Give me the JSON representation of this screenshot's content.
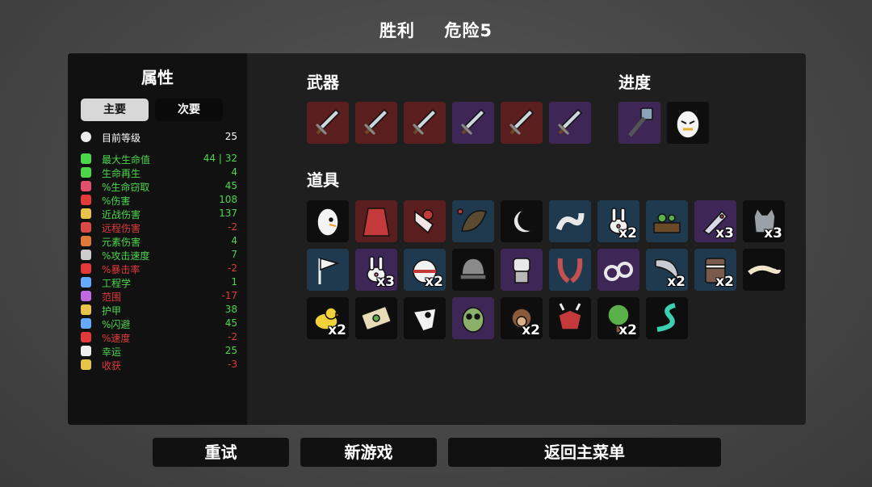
{
  "header": {
    "result": "胜利",
    "danger": "危险5"
  },
  "stats_panel": {
    "title": "属性",
    "tabs": [
      "主要",
      "次要"
    ],
    "level": {
      "label": "目前等级",
      "value": "25"
    },
    "stats": [
      {
        "icon": "heart-icon",
        "label": "最大生命值",
        "value": "44 | 32",
        "color": "#4cd64c"
      },
      {
        "icon": "heart-plus-icon",
        "label": "生命再生",
        "value": "4",
        "color": "#4cd64c"
      },
      {
        "icon": "teeth-icon",
        "label": "%生命窃取",
        "value": "45",
        "color": "#4cd64c"
      },
      {
        "icon": "damage-icon",
        "label": "%伤害",
        "value": "108",
        "color": "#4cd64c"
      },
      {
        "icon": "sword-icon",
        "label": "近战伤害",
        "value": "137",
        "color": "#4cd64c"
      },
      {
        "icon": "bow-icon",
        "label": "远程伤害",
        "value": "-2",
        "color": "#e23a3a"
      },
      {
        "icon": "flame-icon",
        "label": "元素伤害",
        "value": "4",
        "color": "#4cd64c"
      },
      {
        "icon": "hourglass-icon",
        "label": "%攻击速度",
        "value": "7",
        "color": "#4cd64c"
      },
      {
        "icon": "crit-icon",
        "label": "%暴击率",
        "value": "-2",
        "color": "#e23a3a"
      },
      {
        "icon": "wrench-icon",
        "label": "工程学",
        "value": "1",
        "color": "#4cd64c"
      },
      {
        "icon": "range-icon",
        "label": "范围",
        "value": "-17",
        "color": "#e23a3a"
      },
      {
        "icon": "shield-icon",
        "label": "护甲",
        "value": "38",
        "color": "#4cd64c"
      },
      {
        "icon": "dodge-icon",
        "label": "%闪避",
        "value": "45",
        "color": "#4cd64c"
      },
      {
        "icon": "speed-icon",
        "label": "%速度",
        "value": "-2",
        "color": "#e23a3a"
      },
      {
        "icon": "dice-icon",
        "label": "幸运",
        "value": "25",
        "color": "#4cd64c"
      },
      {
        "icon": "harvest-icon",
        "label": "收获",
        "value": "-3",
        "color": "#e23a3a"
      }
    ]
  },
  "weapons": {
    "label": "武器",
    "items": [
      {
        "icon": "sword-icon",
        "tier": "red"
      },
      {
        "icon": "sword-icon",
        "tier": "red"
      },
      {
        "icon": "sword-icon",
        "tier": "red"
      },
      {
        "icon": "sword-icon",
        "tier": "purple"
      },
      {
        "icon": "sword-icon",
        "tier": "red"
      },
      {
        "icon": "sword-icon",
        "tier": "purple"
      }
    ]
  },
  "progress": {
    "label": "进度",
    "items": [
      {
        "icon": "hammer-icon",
        "tier": "purple"
      },
      {
        "icon": "angry-egg-icon",
        "tier": "dark"
      }
    ]
  },
  "items": {
    "label": "道具",
    "list": [
      {
        "icon": "egg-icon",
        "tier": "dark",
        "count": ""
      },
      {
        "icon": "cape-icon",
        "tier": "red",
        "count": ""
      },
      {
        "icon": "bloody-hand-icon",
        "tier": "red",
        "count": ""
      },
      {
        "icon": "cocoon-icon",
        "tier": "blue",
        "count": ""
      },
      {
        "icon": "moon-icon",
        "tier": "dark",
        "count": ""
      },
      {
        "icon": "worm-icon",
        "tier": "blue",
        "count": ""
      },
      {
        "icon": "rabbit-icon",
        "tier": "blue",
        "count": "x2"
      },
      {
        "icon": "garden-icon",
        "tier": "blue",
        "count": ""
      },
      {
        "icon": "fish-icon",
        "tier": "purple",
        "count": "x3"
      },
      {
        "icon": "cat-icon",
        "tier": "dark",
        "count": "x3"
      },
      {
        "icon": "flag-icon",
        "tier": "blue",
        "count": ""
      },
      {
        "icon": "bunny-mask-icon",
        "tier": "purple",
        "count": "x3"
      },
      {
        "icon": "helmet-ball-icon",
        "tier": "blue",
        "count": "x2"
      },
      {
        "icon": "helmet-icon",
        "tier": "dark",
        "count": ""
      },
      {
        "icon": "robot-icon",
        "tier": "purple",
        "count": ""
      },
      {
        "icon": "claws-icon",
        "tier": "blue",
        "count": ""
      },
      {
        "icon": "handcuffs-icon",
        "tier": "purple",
        "count": ""
      },
      {
        "icon": "blade-icon",
        "tier": "blue",
        "count": "x2"
      },
      {
        "icon": "gauntlet-icon",
        "tier": "blue",
        "count": "x2"
      },
      {
        "icon": "lizard-icon",
        "tier": "dark",
        "count": ""
      },
      {
        "icon": "duck-icon",
        "tier": "dark",
        "count": "x2"
      },
      {
        "icon": "banknote-icon",
        "tier": "dark",
        "count": ""
      },
      {
        "icon": "skull-icon",
        "tier": "dark",
        "count": ""
      },
      {
        "icon": "zombie-icon",
        "tier": "purple",
        "count": ""
      },
      {
        "icon": "monkey-icon",
        "tier": "dark",
        "count": "x2"
      },
      {
        "icon": "demon-icon",
        "tier": "dark",
        "count": ""
      },
      {
        "icon": "tree-icon",
        "tier": "dark",
        "count": "x2"
      },
      {
        "icon": "snake-icon",
        "tier": "dark",
        "count": ""
      }
    ]
  },
  "buttons": {
    "retry": "重试",
    "new_game": "新游戏",
    "main_menu": "返回主菜单"
  },
  "colors": {
    "tier_dark": "#0e0e0e",
    "tier_red": "#5a1e1e",
    "tier_purple": "#3e2656",
    "tier_blue": "#1f3a4e",
    "positive": "#4cd64c",
    "negative": "#e23a3a"
  }
}
